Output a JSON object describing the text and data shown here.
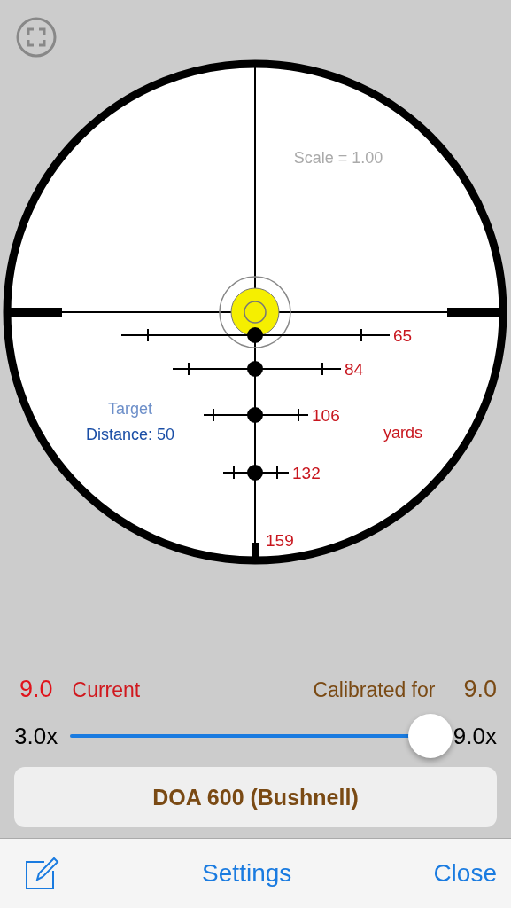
{
  "scope": {
    "scale_text": "Scale = 1.00",
    "target_label": "Target",
    "distance_label": "Distance: 50",
    "unit_label": "yards",
    "ranges": [
      {
        "label": "65",
        "dot": true
      },
      {
        "label": "84",
        "dot": true
      },
      {
        "label": "106",
        "dot": true
      },
      {
        "label": "132",
        "dot": true
      },
      {
        "label": "159",
        "dot": false
      }
    ]
  },
  "power": {
    "current_value": "9.0",
    "current_label": "Current",
    "calibrated_label": "Calibrated for",
    "calibrated_value": "9.0",
    "min_label": "3.0x",
    "max_label": "9.0x",
    "level": 1
  },
  "reticle_button": "DOA 600 (Bushnell)",
  "toolbar": {
    "settings": "Settings",
    "close": "Close"
  }
}
